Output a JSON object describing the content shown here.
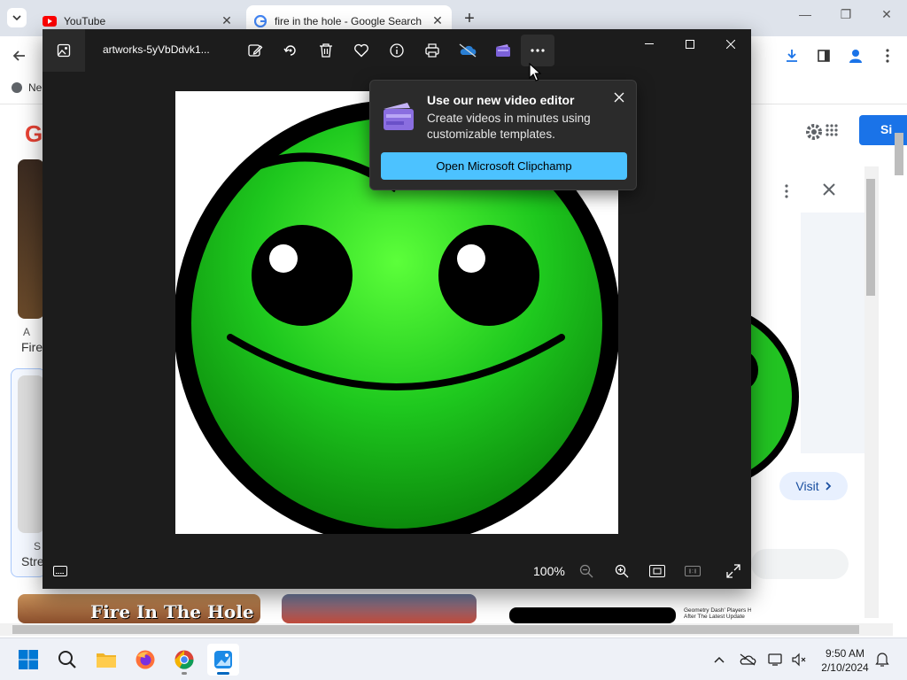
{
  "browser": {
    "tabs": [
      {
        "label": "YouTube",
        "active": false,
        "icon": "youtube-icon"
      },
      {
        "label": "fire in the hole - Google Search",
        "active": true,
        "icon": "google-icon"
      }
    ],
    "bookmark": "Ne",
    "sign_in": "Si",
    "visit_label": "Visit",
    "thumb_texts": {
      "left_top_caption": "A",
      "left_top_title": "Fire",
      "left_bottom_caption": "S",
      "left_bottom_title": "Stre",
      "bottom_thumb_1": "Fire In The Hole",
      "bottom_thumb_3": "Geometry Dash' Players Have Gone Full Lobotomy Mode After The Latest Update"
    }
  },
  "photos": {
    "filename": "artworks-5yVbDdvk1...",
    "zoom": "100%"
  },
  "popup": {
    "title": "Use our new video editor",
    "body": "Create videos in minutes using customizable templates.",
    "cta": "Open Microsoft Clipchamp"
  },
  "taskbar": {
    "time": "9:50 AM",
    "date": "2/10/2024"
  }
}
